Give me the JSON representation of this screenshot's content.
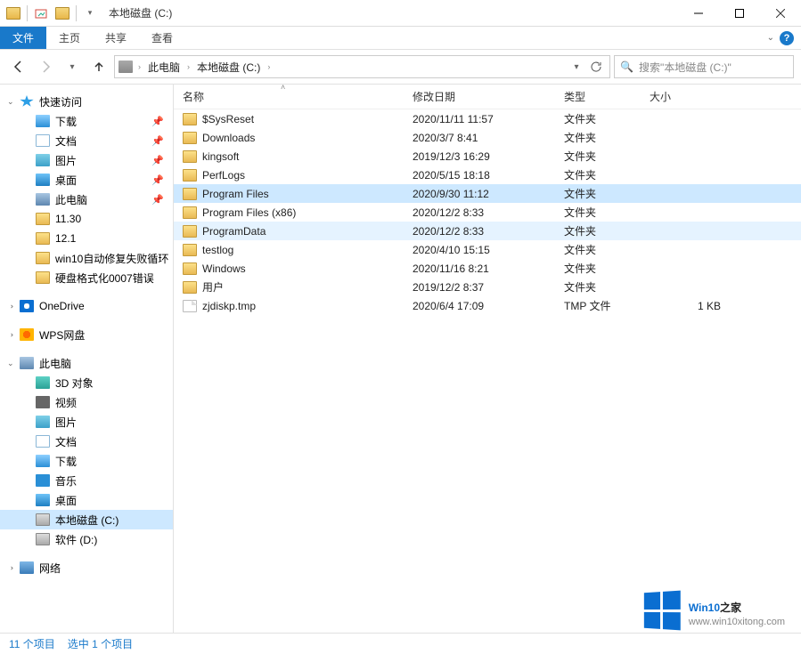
{
  "window": {
    "title": "本地磁盘 (C:)"
  },
  "ribbon": {
    "file": "文件",
    "tabs": [
      "主页",
      "共享",
      "查看"
    ]
  },
  "breadcrumb": {
    "root": "此电脑",
    "leaf": "本地磁盘 (C:)"
  },
  "search": {
    "placeholder": "搜索\"本地磁盘 (C:)\""
  },
  "columns": {
    "name": "名称",
    "date": "修改日期",
    "type": "类型",
    "size": "大小"
  },
  "sidebar": {
    "quick": {
      "label": "快速访问",
      "items": [
        {
          "label": "下载",
          "icon": "dl",
          "pinned": true
        },
        {
          "label": "文档",
          "icon": "doc",
          "pinned": true
        },
        {
          "label": "图片",
          "icon": "pic",
          "pinned": true
        },
        {
          "label": "桌面",
          "icon": "desk",
          "pinned": true
        },
        {
          "label": "此电脑",
          "icon": "pc",
          "pinned": true
        },
        {
          "label": "11.30",
          "icon": "folder",
          "pinned": false
        },
        {
          "label": "12.1",
          "icon": "folder",
          "pinned": false
        },
        {
          "label": "win10自动修复失败循环",
          "icon": "folder",
          "pinned": false
        },
        {
          "label": "硬盘格式化0007错误",
          "icon": "folder",
          "pinned": false
        }
      ]
    },
    "onedrive": "OneDrive",
    "wps": "WPS网盘",
    "thispc": {
      "label": "此电脑",
      "items": [
        {
          "label": "3D 对象",
          "icon": "3d"
        },
        {
          "label": "视频",
          "icon": "vid"
        },
        {
          "label": "图片",
          "icon": "pic"
        },
        {
          "label": "文档",
          "icon": "doc"
        },
        {
          "label": "下载",
          "icon": "dl"
        },
        {
          "label": "音乐",
          "icon": "music"
        },
        {
          "label": "桌面",
          "icon": "desk"
        },
        {
          "label": "本地磁盘 (C:)",
          "icon": "drive",
          "selected": true
        },
        {
          "label": "软件 (D:)",
          "icon": "drive"
        }
      ]
    },
    "network": "网络"
  },
  "files": [
    {
      "name": "$SysReset",
      "date": "2020/11/11 11:57",
      "type": "文件夹",
      "size": "",
      "icon": "folder"
    },
    {
      "name": "Downloads",
      "date": "2020/3/7 8:41",
      "type": "文件夹",
      "size": "",
      "icon": "folder"
    },
    {
      "name": "kingsoft",
      "date": "2019/12/3 16:29",
      "type": "文件夹",
      "size": "",
      "icon": "folder"
    },
    {
      "name": "PerfLogs",
      "date": "2020/5/15 18:18",
      "type": "文件夹",
      "size": "",
      "icon": "folder"
    },
    {
      "name": "Program Files",
      "date": "2020/9/30 11:12",
      "type": "文件夹",
      "size": "",
      "icon": "folder",
      "state": "sel"
    },
    {
      "name": "Program Files (x86)",
      "date": "2020/12/2 8:33",
      "type": "文件夹",
      "size": "",
      "icon": "folder"
    },
    {
      "name": "ProgramData",
      "date": "2020/12/2 8:33",
      "type": "文件夹",
      "size": "",
      "icon": "folder",
      "state": "hov"
    },
    {
      "name": "testlog",
      "date": "2020/4/10 15:15",
      "type": "文件夹",
      "size": "",
      "icon": "folder"
    },
    {
      "name": "Windows",
      "date": "2020/11/16 8:21",
      "type": "文件夹",
      "size": "",
      "icon": "folder"
    },
    {
      "name": "用户",
      "date": "2019/12/2 8:37",
      "type": "文件夹",
      "size": "",
      "icon": "folder"
    },
    {
      "name": "zjdiskp.tmp",
      "date": "2020/6/4 17:09",
      "type": "TMP 文件",
      "size": "1 KB",
      "icon": "file"
    }
  ],
  "status": {
    "count": "11 个项目",
    "selected": "选中 1 个项目"
  },
  "watermark": {
    "line1a": "Win10",
    "line1b": "之家",
    "line2": "www.win10xitong.com"
  }
}
